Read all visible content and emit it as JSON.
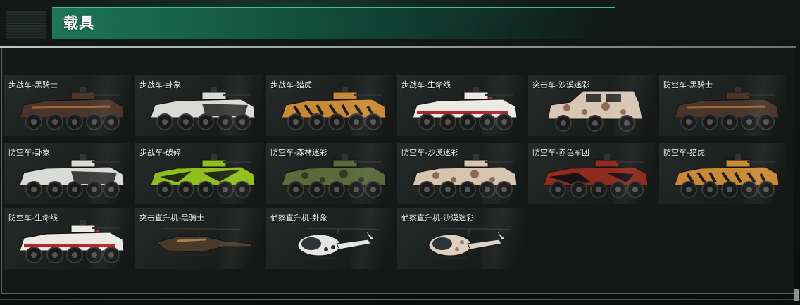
{
  "header": {
    "title": "载具"
  },
  "vehicles": [
    {
      "label": "步战车-黑骑士",
      "kind": "apc",
      "body": "#4a3528",
      "accent": "#9a6a3c",
      "pattern": "dark"
    },
    {
      "label": "步战车-卦象",
      "kind": "apc",
      "body": "#d9d9d6",
      "accent": "#2a2a2a",
      "pattern": "bw"
    },
    {
      "label": "步战车-猎虎",
      "kind": "apc",
      "body": "#c98a35",
      "accent": "#1e1a14",
      "pattern": "tiger"
    },
    {
      "label": "步战车-生命线",
      "kind": "apc",
      "body": "#ece8e4",
      "accent": "#b3262a",
      "pattern": "red"
    },
    {
      "label": "突击车-沙漠迷彩",
      "kind": "truck",
      "body": "#d8c6b4",
      "accent": "#8a6a52",
      "pattern": "desert"
    },
    {
      "label": "防空车-黑骑士",
      "kind": "apc",
      "body": "#4a3528",
      "accent": "#9a6a3c",
      "pattern": "dark"
    },
    {
      "label": "防空车-卦象",
      "kind": "apc",
      "body": "#d9d9d6",
      "accent": "#2a2a2a",
      "pattern": "bw"
    },
    {
      "label": "步战车-破碎",
      "kind": "apc",
      "body": "#8fbf1c",
      "accent": "#111111",
      "pattern": "lime"
    },
    {
      "label": "防空车-森林迷彩",
      "kind": "apc",
      "body": "#5a6a3a",
      "accent": "#2f3a22",
      "pattern": "forest"
    },
    {
      "label": "防空车-沙漠迷彩",
      "kind": "apc",
      "body": "#d6c3b0",
      "accent": "#8a6a52",
      "pattern": "desert"
    },
    {
      "label": "防空车-赤色军团",
      "kind": "apc",
      "body": "#8f2a1c",
      "accent": "#1a1212",
      "pattern": "redblack"
    },
    {
      "label": "防空车-猎虎",
      "kind": "apc",
      "body": "#c98a35",
      "accent": "#1e1a14",
      "pattern": "tiger"
    },
    {
      "label": "防空车-生命线",
      "kind": "apc",
      "body": "#ece8e4",
      "accent": "#b3262a",
      "pattern": "red"
    },
    {
      "label": "突击直升机-黑骑士",
      "kind": "attack-heli",
      "body": "#4a3a2a",
      "accent": "#a58050",
      "pattern": "dark"
    },
    {
      "label": "侦察直升机-卦象",
      "kind": "scout-heli",
      "body": "#e4e4e2",
      "accent": "#2a2a2a",
      "pattern": "bw"
    },
    {
      "label": "侦察直升机-沙漠迷彩",
      "kind": "scout-heli",
      "body": "#ddd0c2",
      "accent": "#8a6a52",
      "pattern": "desert"
    }
  ]
}
